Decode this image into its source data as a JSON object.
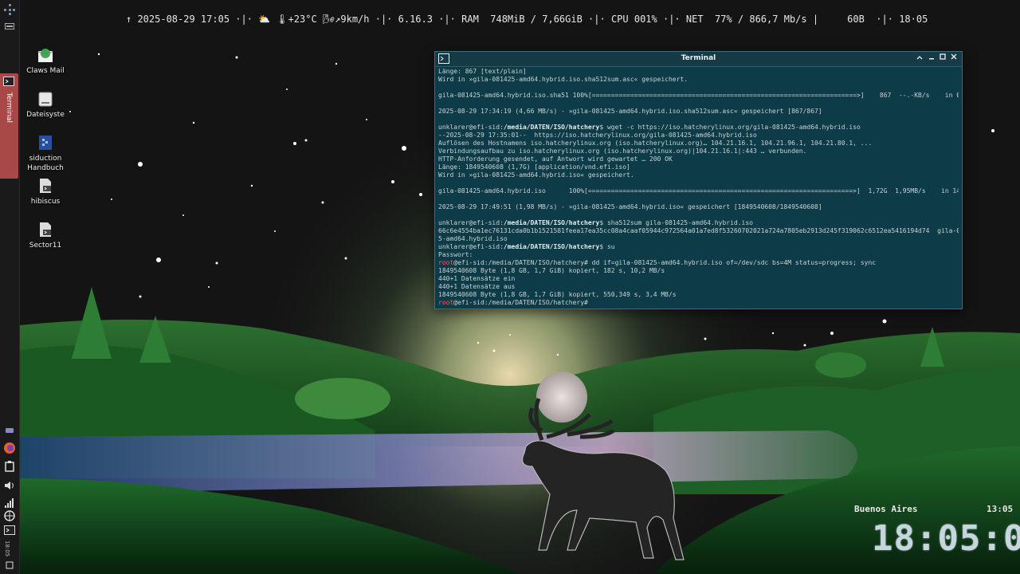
{
  "topbar": {
    "segments": [
      "↑ 2025-08-29 17:05 ·|·",
      " ⛅ 🌡+23°C 🌬↗9km/h ",
      "·|· 6.16.3 ·|·",
      " RAM  748MiB / 7,66GiB ·|·",
      " CPU 001% ·|·",
      " NET  77% / 866,7 Mb/s |",
      "     60B  ·|· 18·05"
    ]
  },
  "left_panel": {
    "task_label": "Terminal",
    "clock": "18:05"
  },
  "desktop_icons": [
    {
      "label": "Claws Mail",
      "icon": "mail-icon"
    },
    {
      "label": "Dateisyste",
      "icon": "drive-icon"
    },
    {
      "label": "siduction Handbuch",
      "icon": "manual-icon"
    },
    {
      "label": "hibiscus",
      "icon": "script-icon"
    },
    {
      "label": "Sector11",
      "icon": "script-icon"
    }
  ],
  "terminal": {
    "title": "Terminal",
    "lines": [
      {
        "t": "Länge: 867 [text/plain]"
      },
      {
        "t": "Wird in »gila-081425-amd64.hybrid.iso.sha512sum.asc« gespeichert."
      },
      {
        "t": ""
      },
      {
        "t": "gila-081425-amd64.hybrid.iso.sha51 100%[=====================================================================>]    867  --.-KB/s    in 0s"
      },
      {
        "t": ""
      },
      {
        "t": "2025-08-29 17:34:19 (4,66 MB/s) - »gila-081425-amd64.hybrid.iso.sha512sum.asc« gespeichert [867/867]"
      },
      {
        "t": ""
      },
      {
        "u": "unklarer@efi-sid:",
        "p": "/media/DATEN/ISO/hatchery",
        "c": "$ wget -c https://iso.hatcherylinux.org/gila-081425-amd64.hybrid.iso"
      },
      {
        "t": "--2025-08-29 17:35:01--  https://iso.hatcherylinux.org/gila-081425-amd64.hybrid.iso"
      },
      {
        "t": "Auflösen des Hostnamens iso.hatcherylinux.org (iso.hatcherylinux.org)… 104.21.16.1, 104.21.96.1, 104.21.80.1, ..."
      },
      {
        "t": "Verbindungsaufbau zu iso.hatcherylinux.org (iso.hatcherylinux.org)|104.21.16.1|:443 … verbunden."
      },
      {
        "t": "HTTP-Anforderung gesendet, auf Antwort wird gewartet … 200 OK"
      },
      {
        "t": "Länge: 1849540608 (1,7G) [application/vnd.efi.iso]"
      },
      {
        "t": "Wird in »gila-081425-amd64.hybrid.iso« gespeichert."
      },
      {
        "t": ""
      },
      {
        "t": "gila-081425-amd64.hybrid.iso      100%[=====================================================================>]  1,72G  1,95MB/s    in 14m 49s"
      },
      {
        "t": ""
      },
      {
        "t": "2025-08-29 17:49:51 (1,98 MB/s) - »gila-081425-amd64.hybrid.iso« gespeichert [1849540608/1849540608]"
      },
      {
        "t": ""
      },
      {
        "u": "unklarer@efi-sid:",
        "p": "/media/DATEN/ISO/hatchery",
        "c": "$ sha512sum gila-081425-amd64.hybrid.iso"
      },
      {
        "t": "66c6e4554ba1ec76131cda0b1b1521581feea17ea35cc08a4caaf05944c972564a01a7ed8f53260702021a724a7805eb2913d245f319062c6512ea5416194d74  gila-08142"
      },
      {
        "t": "5-amd64.hybrid.iso"
      },
      {
        "u": "unklarer@efi-sid:",
        "p": "/media/DATEN/ISO/hatchery",
        "c": "$ su"
      },
      {
        "t": "Passwort:"
      },
      {
        "r": "root",
        "u": "@efi-sid:/media/DATEN/ISO/hatchery",
        "c": "# dd if=gila-081425-amd64.hybrid.iso of=/dev/sdc bs=4M status=progress; sync"
      },
      {
        "t": "1849540608 Byte (1,8 GB, 1,7 GiB) kopiert, 182 s, 10,2 MB/s"
      },
      {
        "t": "440+1 Datensätze ein"
      },
      {
        "t": "440+1 Datensätze aus"
      },
      {
        "t": "1849540608 Byte (1,8 GB, 1,7 GiB) kopiert, 550,349 s, 3,4 MB/s"
      },
      {
        "r": "root",
        "u": "@efi-sid:/media/DATEN/ISO/hatchery",
        "c": "#"
      }
    ]
  },
  "world_clock": {
    "city": "Buenos Aires",
    "city_time": "13:05",
    "big_time": "18:05:08"
  },
  "colors": {
    "terminal_bg": "#0d3b47",
    "root_prompt": "#ff5555",
    "task_active": "#a84848"
  }
}
